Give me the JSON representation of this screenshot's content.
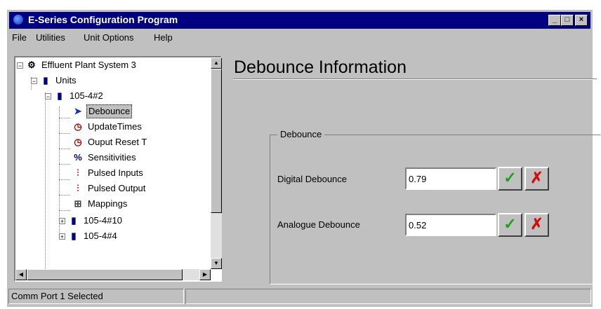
{
  "window": {
    "title": "E-Series Configuration Program",
    "controls": {
      "minimize": "_",
      "maximize": "□",
      "close": "×"
    }
  },
  "menu": [
    "File",
    "Utilities",
    "Unit Options",
    "Help"
  ],
  "tree": {
    "root": "Effluent Plant System 3",
    "units": "Units",
    "unit1": "105-4#2",
    "children": [
      {
        "label": "Debounce",
        "icon": "arrow-icon",
        "selected": true
      },
      {
        "label": "UpdateTimes",
        "icon": "clock-icon"
      },
      {
        "label": "Ouput Reset T",
        "icon": "clock-icon"
      },
      {
        "label": "Sensitivities",
        "icon": "percent-icon"
      },
      {
        "label": "Pulsed Inputs",
        "icon": "pulse-in-icon"
      },
      {
        "label": "Pulsed Output",
        "icon": "pulse-out-icon"
      },
      {
        "label": "Mappings",
        "icon": "mapping-icon"
      }
    ],
    "unit2": "105-4#10",
    "unit3": "105-4#4"
  },
  "panel": {
    "title": "Debounce Information",
    "group_title": "Debounce",
    "digital_label": "Digital Debounce",
    "digital_value": "0.79",
    "analogue_label": "Analogue Debounce",
    "analogue_value": "0.52",
    "ok_glyph": "✓",
    "cancel_glyph": "✗"
  },
  "status": {
    "text": "Comm Port 1 Selected"
  },
  "colors": {
    "titlebar": "#000080",
    "face": "#c0c0c0",
    "ok": "#20a020",
    "cancel": "#d01010"
  }
}
